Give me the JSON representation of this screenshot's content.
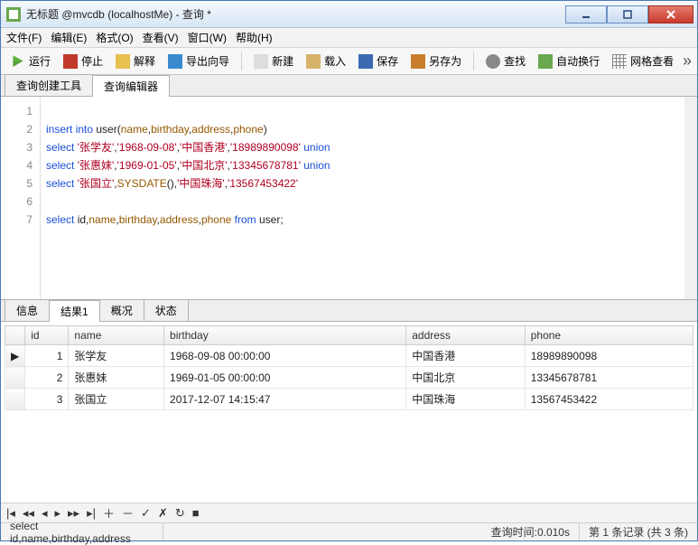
{
  "window": {
    "title": "无标题 @mvcdb (localhostMe) - 查询 *"
  },
  "menu": {
    "file": "文件(F)",
    "edit": "编辑(E)",
    "format": "格式(O)",
    "view": "查看(V)",
    "window": "窗口(W)",
    "help": "帮助(H)"
  },
  "toolbar": {
    "run": "运行",
    "stop": "停止",
    "explain": "解释",
    "wizard": "导出向导",
    "new": "新建",
    "load": "载入",
    "save": "保存",
    "saveas": "另存为",
    "find": "查找",
    "wrap": "自动换行",
    "gridview": "网格查看"
  },
  "top_tabs": {
    "builder": "查询创建工具",
    "editor": "查询编辑器"
  },
  "editor": {
    "line_count": 7,
    "tokens": [
      [],
      [
        {
          "t": "insert",
          "c": "kw"
        },
        {
          "t": " ",
          "c": "pn"
        },
        {
          "t": "into",
          "c": "kw"
        },
        {
          "t": " user",
          "c": "pn"
        },
        {
          "t": "(",
          "c": "pn"
        },
        {
          "t": "name",
          "c": "fn"
        },
        {
          "t": ",",
          "c": "pn"
        },
        {
          "t": "birthday",
          "c": "fn"
        },
        {
          "t": ",",
          "c": "pn"
        },
        {
          "t": "address",
          "c": "fn"
        },
        {
          "t": ",",
          "c": "pn"
        },
        {
          "t": "phone",
          "c": "fn"
        },
        {
          "t": ")",
          "c": "pn"
        }
      ],
      [
        {
          "t": "select",
          "c": "kw"
        },
        {
          "t": " ",
          "c": "pn"
        },
        {
          "t": "'张学友'",
          "c": "str"
        },
        {
          "t": ",",
          "c": "pn"
        },
        {
          "t": "'1968-09-08'",
          "c": "str"
        },
        {
          "t": ",",
          "c": "pn"
        },
        {
          "t": "'中国香港'",
          "c": "str"
        },
        {
          "t": ",",
          "c": "pn"
        },
        {
          "t": "'18989890098'",
          "c": "str"
        },
        {
          "t": " ",
          "c": "pn"
        },
        {
          "t": "union",
          "c": "kw"
        }
      ],
      [
        {
          "t": "select",
          "c": "kw"
        },
        {
          "t": " ",
          "c": "pn"
        },
        {
          "t": "'张惠妹'",
          "c": "str"
        },
        {
          "t": ",",
          "c": "pn"
        },
        {
          "t": "'1969-01-05'",
          "c": "str"
        },
        {
          "t": ",",
          "c": "pn"
        },
        {
          "t": "'中国北京'",
          "c": "str"
        },
        {
          "t": ",",
          "c": "pn"
        },
        {
          "t": "'13345678781'",
          "c": "str"
        },
        {
          "t": " ",
          "c": "pn"
        },
        {
          "t": "union",
          "c": "kw"
        }
      ],
      [
        {
          "t": "select",
          "c": "kw"
        },
        {
          "t": " ",
          "c": "pn"
        },
        {
          "t": "'张国立'",
          "c": "str"
        },
        {
          "t": ",",
          "c": "pn"
        },
        {
          "t": "SYSDATE",
          "c": "fn"
        },
        {
          "t": "(),",
          "c": "pn"
        },
        {
          "t": "'中国珠海'",
          "c": "str"
        },
        {
          "t": ",",
          "c": "pn"
        },
        {
          "t": "'13567453422'",
          "c": "str"
        }
      ],
      [],
      [
        {
          "t": "select",
          "c": "kw"
        },
        {
          "t": " id,",
          "c": "pn"
        },
        {
          "t": "name",
          "c": "fn"
        },
        {
          "t": ",",
          "c": "pn"
        },
        {
          "t": "birthday",
          "c": "fn"
        },
        {
          "t": ",",
          "c": "pn"
        },
        {
          "t": "address",
          "c": "fn"
        },
        {
          "t": ",",
          "c": "pn"
        },
        {
          "t": "phone",
          "c": "fn"
        },
        {
          "t": " ",
          "c": "pn"
        },
        {
          "t": "from",
          "c": "kw"
        },
        {
          "t": " user;",
          "c": "pn"
        }
      ]
    ]
  },
  "bottom_tabs": {
    "info": "信息",
    "result": "结果1",
    "profile": "概况",
    "status": "状态"
  },
  "grid": {
    "columns": [
      "id",
      "name",
      "birthday",
      "address",
      "phone"
    ],
    "rows": [
      {
        "id": "1",
        "name": "张学友",
        "birthday": "1968-09-08 00:00:00",
        "address": "中国香港",
        "phone": "18989890098"
      },
      {
        "id": "2",
        "name": "张惠妹",
        "birthday": "1969-01-05 00:00:00",
        "address": "中国北京",
        "phone": "13345678781"
      },
      {
        "id": "3",
        "name": "张国立",
        "birthday": "2017-12-07 14:15:47",
        "address": "中国珠海",
        "phone": "13567453422"
      }
    ]
  },
  "status": {
    "sql": "select id,name,birthday,address",
    "time_label": "查询时间: ",
    "time_value": "0.010s",
    "record": "第 1 条记录 (共 3 条)"
  }
}
